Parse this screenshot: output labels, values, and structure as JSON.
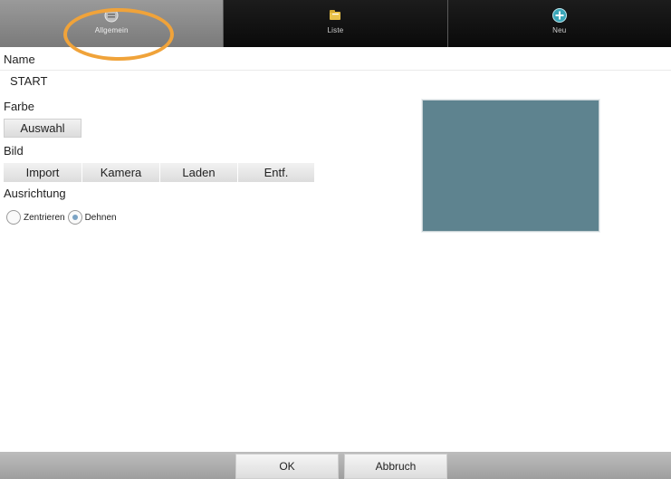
{
  "tabs": [
    {
      "label": "Allgemein",
      "icon": "general-icon",
      "active": true
    },
    {
      "label": "Liste",
      "icon": "folder-list-icon",
      "active": false
    },
    {
      "label": "Neu",
      "icon": "add-circle-icon",
      "active": false
    }
  ],
  "form": {
    "name_label": "Name",
    "name_value": "START",
    "color_label": "Farbe",
    "color_button": "Auswahl",
    "image_label": "Bild",
    "image_buttons": [
      "Import",
      "Kamera",
      "Laden",
      "Entf."
    ],
    "alignment_label": "Ausrichtung",
    "alignment_options": [
      {
        "label": "Zentrieren",
        "selected": false
      },
      {
        "label": "Dehnen",
        "selected": true
      }
    ]
  },
  "preview": {
    "color": "#5e838f"
  },
  "footer": {
    "ok_label": "OK",
    "cancel_label": "Abbruch"
  },
  "colors": {
    "highlight": "#f0a33a",
    "accent": "#7aa3c4"
  }
}
